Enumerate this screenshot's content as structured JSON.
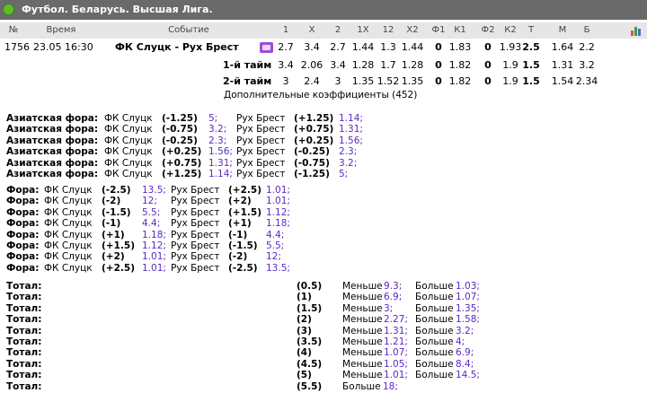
{
  "header": {
    "title": "Футбол. Беларусь. Высшая Лига."
  },
  "columns": [
    "№",
    "Время",
    "Событие",
    "1",
    "X",
    "2",
    "1X",
    "12",
    "X2",
    "Ф1",
    "К1",
    "Ф2",
    "К2",
    "Т",
    "М",
    "Б"
  ],
  "match": {
    "num": "1756",
    "time": "23.05 16:30",
    "event": "ФК Слуцк - Рух Брест",
    "odds": [
      "2.7",
      "3.4",
      "2.7",
      "1.44",
      "1.3",
      "1.44",
      "0",
      "1.83",
      "0",
      "1.93",
      "2.5",
      "1.64",
      "2.2"
    ]
  },
  "halves": [
    {
      "label": "1-й тайм",
      "odds": [
        "3.4",
        "2.06",
        "3.4",
        "1.28",
        "1.7",
        "1.28",
        "0",
        "1.82",
        "0",
        "1.9",
        "1.5",
        "1.31",
        "3.2"
      ]
    },
    {
      "label": "2-й тайм",
      "odds": [
        "3",
        "2.4",
        "3",
        "1.35",
        "1.52",
        "1.35",
        "0",
        "1.82",
        "0",
        "1.9",
        "1.5",
        "1.54",
        "2.34"
      ]
    }
  ],
  "additional": "Дополнительные коэффициенты (452)",
  "asian": {
    "label": "Азиатская фора:",
    "rows": [
      {
        "t1": "ФК Слуцк",
        "h1": "(-1.25)",
        "o1": "5;",
        "t2": "Рух Брест",
        "h2": "(+1.25)",
        "o2": "1.14;"
      },
      {
        "t1": "ФК Слуцк",
        "h1": "(-0.75)",
        "o1": "3.2;",
        "t2": "Рух Брест",
        "h2": "(+0.75)",
        "o2": "1.31;"
      },
      {
        "t1": "ФК Слуцк",
        "h1": "(-0.25)",
        "o1": "2.3;",
        "t2": "Рух Брест",
        "h2": "(+0.25)",
        "o2": "1.56;"
      },
      {
        "t1": "ФК Слуцк",
        "h1": "(+0.25)",
        "o1": "1.56;",
        "t2": "Рух Брест",
        "h2": "(-0.25)",
        "o2": "2.3;"
      },
      {
        "t1": "ФК Слуцк",
        "h1": "(+0.75)",
        "o1": "1.31;",
        "t2": "Рух Брест",
        "h2": "(-0.75)",
        "o2": "3.2;"
      },
      {
        "t1": "ФК Слуцк",
        "h1": "(+1.25)",
        "o1": "1.14;",
        "t2": "Рух Брест",
        "h2": "(-1.25)",
        "o2": "5;"
      }
    ]
  },
  "handicap": {
    "label": "Фора:",
    "rows": [
      {
        "t1": "ФК Слуцк",
        "h1": "(-2.5)",
        "o1": "13.5;",
        "t2": "Рух Брест",
        "h2": "(+2.5)",
        "o2": "1.01;"
      },
      {
        "t1": "ФК Слуцк",
        "h1": "(-2)",
        "o1": "12;",
        "t2": "Рух Брест",
        "h2": "(+2)",
        "o2": "1.01;"
      },
      {
        "t1": "ФК Слуцк",
        "h1": "(-1.5)",
        "o1": "5.5;",
        "t2": "Рух Брест",
        "h2": "(+1.5)",
        "o2": "1.12;"
      },
      {
        "t1": "ФК Слуцк",
        "h1": "(-1)",
        "o1": "4.4;",
        "t2": "Рух Брест",
        "h2": "(+1)",
        "o2": "1.18;"
      },
      {
        "t1": "ФК Слуцк",
        "h1": "(+1)",
        "o1": "1.18;",
        "t2": "Рух Брест",
        "h2": "(-1)",
        "o2": "4.4;"
      },
      {
        "t1": "ФК Слуцк",
        "h1": "(+1.5)",
        "o1": "1.12;",
        "t2": "Рух Брест",
        "h2": "(-1.5)",
        "o2": "5.5;"
      },
      {
        "t1": "ФК Слуцк",
        "h1": "(+2)",
        "o1": "1.01;",
        "t2": "Рух Брест",
        "h2": "(-2)",
        "o2": "12;"
      },
      {
        "t1": "ФК Слуцк",
        "h1": "(+2.5)",
        "o1": "1.01;",
        "t2": "Рух Брест",
        "h2": "(-2.5)",
        "o2": "13.5;"
      }
    ]
  },
  "totals": {
    "label": "Тотал:",
    "rows": [
      {
        "line": "(0.5)",
        "under_label": "Меньше",
        "under": "9.3;",
        "over_label": "Больше",
        "over": "1.03;"
      },
      {
        "line": "(1)",
        "under_label": "Меньше",
        "under": "6.9;",
        "over_label": "Больше",
        "over": "1.07;"
      },
      {
        "line": "(1.5)",
        "under_label": "Меньше",
        "under": "3;",
        "over_label": "Больше",
        "over": "1.35;"
      },
      {
        "line": "(2)",
        "under_label": "Меньше",
        "under": "2.27;",
        "over_label": "Больше",
        "over": "1.58;"
      },
      {
        "line": "(3)",
        "under_label": "Меньше",
        "under": "1.31;",
        "over_label": "Больше",
        "over": "3.2;"
      },
      {
        "line": "(3.5)",
        "under_label": "Меньше",
        "under": "1.21;",
        "over_label": "Больше",
        "over": "4;"
      },
      {
        "line": "(4)",
        "under_label": "Меньше",
        "under": "1.07;",
        "over_label": "Больше",
        "over": "6.9;"
      },
      {
        "line": "(4.5)",
        "under_label": "Меньше",
        "under": "1.05;",
        "over_label": "Больше",
        "over": "8.4;"
      },
      {
        "line": "(5)",
        "under_label": "Меньше",
        "under": "1.01;",
        "over_label": "Больше",
        "over": "14.5;"
      },
      {
        "line": "(5.5)",
        "under_label": "",
        "under": "",
        "over_label": "Больше",
        "over": "18;"
      }
    ]
  },
  "icons": {
    "sport": "football-icon",
    "tv": "tv-icon",
    "stats": "stats-icon"
  },
  "colors": {
    "header_bg": "#6a6a6a",
    "odds": "#5a29c4",
    "tv": "#a34ad6"
  }
}
